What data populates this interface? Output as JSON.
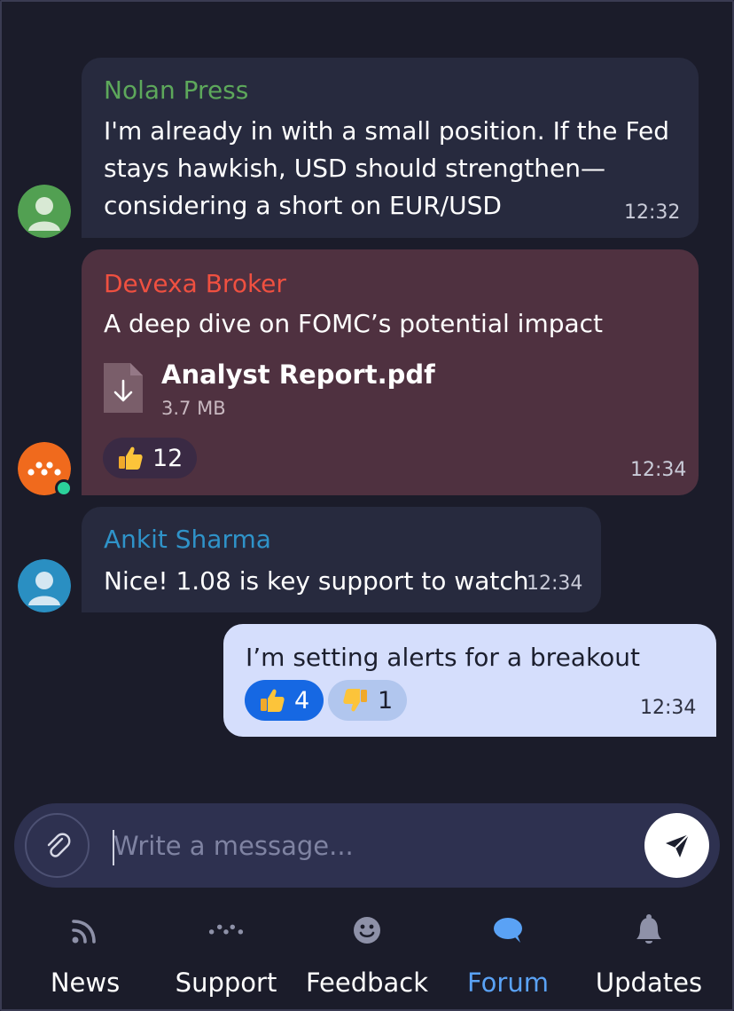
{
  "messages": [
    {
      "sender": "Nolan Press",
      "sender_color": "#5da85b",
      "lines": [
        "I'm already in with a small position. If the Fed",
        "stays hawkish, USD should strengthen—",
        "considering a short on EUR/USD"
      ],
      "time": "12:32"
    },
    {
      "sender": "Devexa Broker",
      "sender_color": "#ef5040",
      "text": "A deep dive on FOMC’s potential impact",
      "file": {
        "name": "Analyst Report.pdf",
        "size": "3.7 MB"
      },
      "reactions": [
        {
          "emoji": "thumbs-up",
          "count": "12"
        }
      ],
      "time": "12:34",
      "online": true
    },
    {
      "sender": "Ankit Sharma",
      "sender_color": "#2f93c9",
      "text": "Nice! 1.08 is key support to watch",
      "time": "12:34"
    },
    {
      "text": "I’m setting alerts for a breakout",
      "reactions": [
        {
          "emoji": "thumbs-up",
          "count": "4",
          "selected": true
        },
        {
          "emoji": "thumbs-down",
          "count": "1",
          "selected": false
        }
      ],
      "time": "12:34"
    }
  ],
  "composer": {
    "placeholder": "Write a message...",
    "value": ""
  },
  "tabs": [
    {
      "label": "News",
      "icon": "rss-icon",
      "active": false
    },
    {
      "label": "Support",
      "icon": "dots-icon",
      "active": false
    },
    {
      "label": "Feedback",
      "icon": "smiley-icon",
      "active": false
    },
    {
      "label": "Forum",
      "icon": "chat-bubble-icon",
      "active": true
    },
    {
      "label": "Updates",
      "icon": "bell-icon",
      "active": false
    }
  ],
  "colors": {
    "background": "#1b1c2a",
    "incoming_bubble": "#272a3e",
    "broker_bubble": "#4f3140",
    "outgoing_bubble": "#d5defc",
    "accent": "#5aa2f5",
    "reaction_selected": "#1668e3",
    "online": "#2bd19a"
  }
}
